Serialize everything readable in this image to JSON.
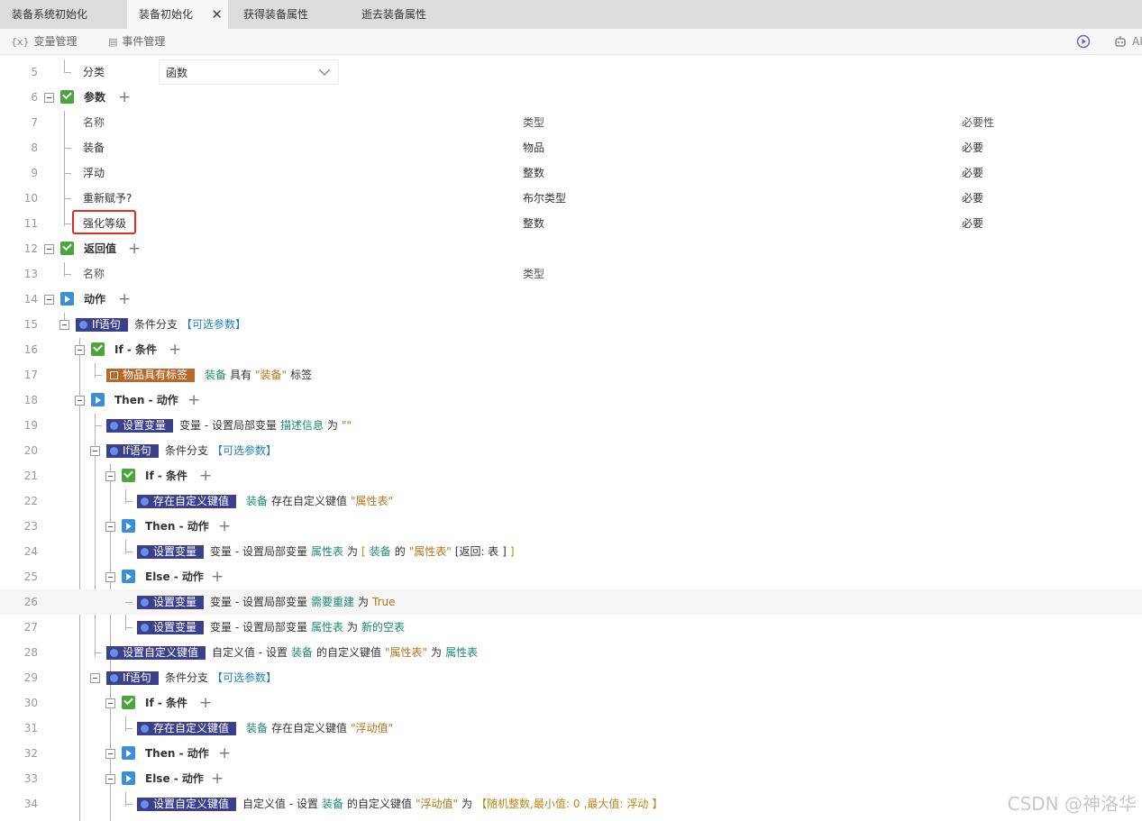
{
  "tabs": [
    {
      "label": "装备系统初始化"
    },
    {
      "label": "装备初始化",
      "close": "✕"
    },
    {
      "label": "获得装备属性"
    },
    {
      "label": "逝去装备属性"
    }
  ],
  "toolbar": {
    "var_icon": "{x}",
    "var_label": "变量管理",
    "event_label": "事件管理",
    "right_text": "AI",
    "right_icons": [
      "play-circle-icon",
      "robot-icon"
    ]
  },
  "rows": {
    "r5": {
      "label": "分类",
      "value": "函数"
    },
    "r6": {
      "label": "参数"
    },
    "r7": {
      "c1": "名称",
      "c2": "类型",
      "c3": "必要性"
    },
    "r8": {
      "c1": "装备",
      "c2": "物品",
      "c3": "必要"
    },
    "r9": {
      "c1": "浮动",
      "c2": "整数",
      "c3": "必要"
    },
    "r10": {
      "c1": "重新赋予?",
      "c2": "布尔类型",
      "c3": "必要"
    },
    "r11": {
      "c1": "强化等级",
      "c2": "整数",
      "c3": "必要"
    },
    "r12": {
      "label": "返回值"
    },
    "r13": {
      "c1": "名称",
      "c2": "类型"
    },
    "r14": {
      "label": "动作"
    },
    "r15": {
      "pill": "If语句",
      "text": "条件分支",
      "opt": "【可选参数】"
    },
    "r16": {
      "label": "If - 条件"
    },
    "r17": {
      "pill": "物品具有标签",
      "a": "装备",
      "b": "具有",
      "c": "\"装备\"",
      "d": "标签"
    },
    "r18": {
      "label": "Then - 动作"
    },
    "r19": {
      "pill": "设置变量",
      "a": "变量 - 设置局部变量",
      "b": "描述信息",
      "c": "为",
      "d": "\"\""
    },
    "r20": {
      "pill": "If语句",
      "text": "条件分支",
      "opt": "【可选参数】"
    },
    "r21": {
      "label": "If - 条件"
    },
    "r22": {
      "pill": "存在自定义键值",
      "a": "装备",
      "b": "存在自定义键值",
      "c": "\"属性表\""
    },
    "r23": {
      "label": "Then - 动作"
    },
    "r24": {
      "pill": "设置变量",
      "a": "变量 - 设置局部变量",
      "b": "属性表",
      "c": "为",
      "d": "[",
      "e": "装备",
      "f": "的",
      "g": "\"属性表\"",
      "h": "[返回: 表 ]",
      "i": "]"
    },
    "r25": {
      "label": "Else - 动作"
    },
    "r26": {
      "pill": "设置变量",
      "a": "变量 - 设置局部变量",
      "b": "需要重建",
      "c": "为",
      "d": "True"
    },
    "r27": {
      "pill": "设置变量",
      "a": "变量 - 设置局部变量",
      "b": "属性表",
      "c": "为",
      "d": "新的空表"
    },
    "r28": {
      "pill": "设置自定义键值",
      "a": "自定义值 - 设置",
      "b": "装备",
      "c": "的自定义键值",
      "d": "\"属性表\"",
      "e": "为",
      "f": "属性表"
    },
    "r29": {
      "pill": "If语句",
      "text": "条件分支",
      "opt": "【可选参数】"
    },
    "r30": {
      "label": "If - 条件"
    },
    "r31": {
      "pill": "存在自定义键值",
      "a": "装备",
      "b": "存在自定义键值",
      "c": "\"浮动值\""
    },
    "r32": {
      "label": "Then - 动作"
    },
    "r33": {
      "label": "Else - 动作"
    },
    "r34": {
      "pill": "设置自定义键值",
      "a": "自定义值 - 设置",
      "b": "装备",
      "c": "的自定义键值",
      "d": "\"浮动值\"",
      "e": "为",
      "f": "【随机整数,最小值:",
      "g": "0",
      "h": ",最大值:",
      "i": "浮动",
      "j": "】"
    }
  },
  "line_numbers": [
    "5",
    "6",
    "7",
    "8",
    "9",
    "10",
    "11",
    "12",
    "13",
    "14",
    "15",
    "16",
    "17",
    "18",
    "19",
    "20",
    "21",
    "22",
    "23",
    "24",
    "25",
    "26",
    "27",
    "28",
    "29",
    "30",
    "31",
    "32",
    "33",
    "34"
  ],
  "plus_symbol": "+",
  "watermark": "CSDN @神洛华"
}
